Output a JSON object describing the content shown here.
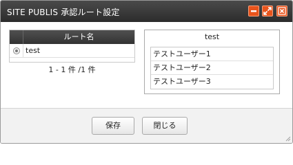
{
  "window": {
    "title": "SITE PUBLIS 承認ルート設定",
    "controls": {
      "minimize_icon": "minimize-icon",
      "maximize_icon": "maximize-icon",
      "close_icon": "close-icon"
    },
    "accent_color": "#e8541c"
  },
  "route_table": {
    "column_header": "ルート名",
    "rows": [
      {
        "name": "test",
        "selected": true
      }
    ],
    "pager": "1 - 1 件 /1 件"
  },
  "detail_panel": {
    "title": "test",
    "users": [
      "テストユーザー1",
      "テストユーザー2",
      "テストユーザー3"
    ]
  },
  "footer": {
    "save_label": "保存",
    "close_label": "閉じる"
  }
}
